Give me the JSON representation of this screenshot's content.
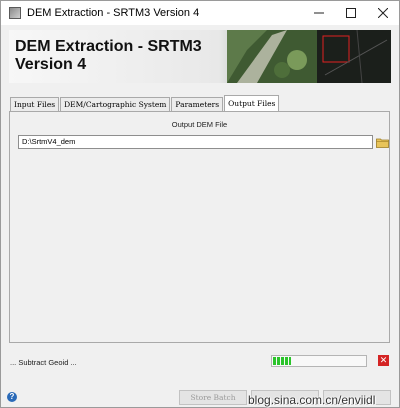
{
  "window": {
    "title": "DEM Extraction - SRTM3 Version 4"
  },
  "banner": {
    "title_line1": "DEM Extraction - SRTM3",
    "title_line2": "Version 4"
  },
  "tabs": [
    {
      "label": "Input Files",
      "active": false
    },
    {
      "label": "DEM/Cartographic System",
      "active": false
    },
    {
      "label": "Parameters",
      "active": false
    },
    {
      "label": "Output Files",
      "active": true
    }
  ],
  "output": {
    "section_label": "Output DEM File",
    "path_value": "D:\\SrtmV4_dem"
  },
  "status": {
    "text": "... Subtract Geoid ...",
    "progress_fraction": 0.2
  },
  "buttons": {
    "store_batch": "Store Batch"
  },
  "watermark": "blog.sina.com.cn/enviidl",
  "colors": {
    "progress": "#2bc42b",
    "cancel": "#d42424",
    "help": "#2a6ab8"
  }
}
